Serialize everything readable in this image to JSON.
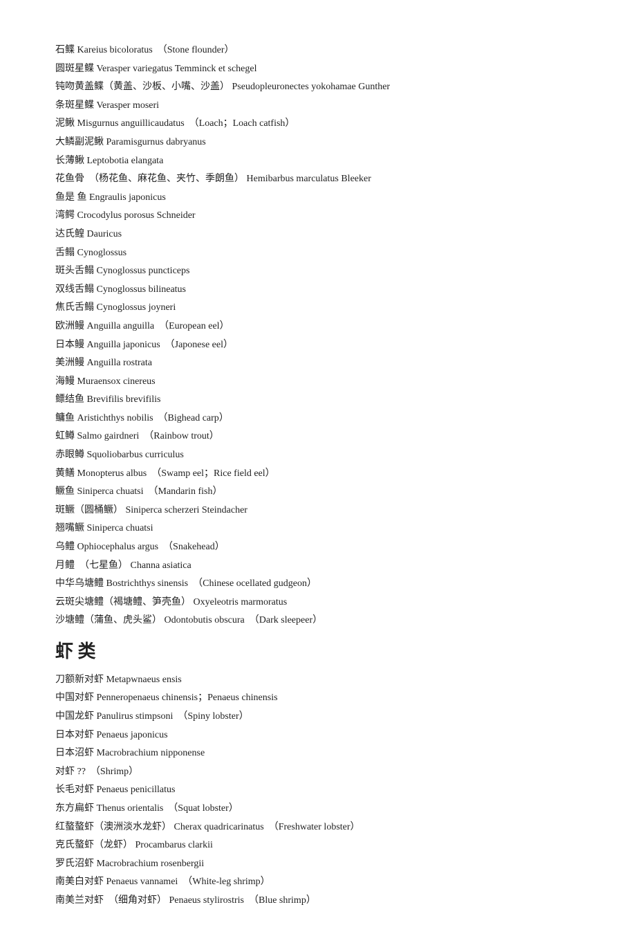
{
  "entries": [
    {
      "text": "石鲽 Kareius bicoloratus　（Stone flounder）"
    },
    {
      "text": "圆斑星鲽 Verasper variegatus Temminck et schegel"
    },
    {
      "text": "钝吻黄盖鲽（黄盖、沙板、小嘴、沙盖）  Pseudopleuronectes yokohamae Gunther"
    },
    {
      "text": "条斑星鲽 Verasper moseri"
    },
    {
      "text": "泥鳅  Misgurnus anguillicaudatus　（Loach；Loach catfish）"
    },
    {
      "text": "大鳞副泥鳅 Paramisgurnus dabryanus"
    },
    {
      "text": "长薄鳅 Leptobotia elangata"
    },
    {
      "text": "花鱼骨　（杨花鱼、麻花鱼、夹竹、季朗鱼）  Hemibarbus marculatus Bleeker"
    },
    {
      "text": "鱼是 鱼 Engraulis japonicus"
    },
    {
      "text": "湾鳄 Crocodylus porosus Schneider"
    },
    {
      "text": "达氏鳇 Dauricus"
    },
    {
      "text": "舌鳎 Cynoglossus"
    },
    {
      "text": "斑头舌鳎 Cynoglossus puncticeps"
    },
    {
      "text": "双线舌鳎 Cynoglossus bilineatus"
    },
    {
      "text": "焦氏舌鳎 Cynoglossus joyneri"
    },
    {
      "text": "欧洲鳗 Anguilla anguilla　（European eel）"
    },
    {
      "text": "日本鳗 Anguilla japonicus　（Japonese eel）"
    },
    {
      "text": "美洲鳗 Anguilla rostrata"
    },
    {
      "text": "海鳗 Muraensox cinereus"
    },
    {
      "text": "鳔结鱼 Brevifilis brevifilis"
    },
    {
      "text": "鳙鱼 Aristichthys nobilis　（Bighead carp）"
    },
    {
      "text": "虹鳟 Salmo gairdneri　（Rainbow trout）"
    },
    {
      "text": "赤眼鳟 Squoliobarbus curriculus"
    },
    {
      "text": "黄鳝 Monopterus albus　（Swamp eel；Rice field eel）"
    },
    {
      "text": "鳜鱼 Siniperca chuatsi　（Mandarin fish）"
    },
    {
      "text": "斑鳜（圆桶鳜）  Siniperca scherzeri Steindacher"
    },
    {
      "text": "翘嘴鳜 Siniperca chuatsi"
    },
    {
      "text": "乌鳢 Ophiocephalus argus　（Snakehead）"
    },
    {
      "text": "月鳢　（七星鱼）  Channa asiatica"
    },
    {
      "text": "中华乌塘鳢 Bostrichthys sinensis　（Chinese ocellated gudgeon）"
    },
    {
      "text": "云斑尖塘鳢（褐塘鳢、笋壳鱼）  Oxyeleotris marmoratus"
    },
    {
      "text": "沙塘鳢（蒲鱼、虎头鲨）  Odontobutis obscura　（Dark sleepeer）"
    }
  ],
  "section_header": "虾 类",
  "shrimp_entries": [
    {
      "text": "刀额新对虾 Metapwnaeus ensis"
    },
    {
      "text": "中国对虾 Penneropenaeus chinensis；Penaeus chinensis"
    },
    {
      "text": "中国龙虾 Panulirus stimpsoni　（Spiny lobster）"
    },
    {
      "text": "日本对虾 Penaeus japonicus"
    },
    {
      "text": "日本沼虾 Macrobrachium nipponense"
    },
    {
      "text": "对虾 ??　（Shrimp）"
    },
    {
      "text": "长毛对虾 Penaeus penicillatus"
    },
    {
      "text": "东方扁虾 Thenus orientalis　（Squat lobster）"
    },
    {
      "text": "红螯螯虾（澳洲淡水龙虾）  Cherax quadricarinatus　（Freshwater lobster）"
    },
    {
      "text": "克氏螯虾（龙虾）  Procambarus clarkii"
    },
    {
      "text": "罗氏沼虾 Macrobrachium rosenbergii"
    },
    {
      "text": "南美白对虾 Penaeus vannamei　（White-leg shrimp）"
    },
    {
      "text": "南美兰对虾　（细角对虾）  Penaeus stylirostris　（Blue shrimp）"
    }
  ]
}
